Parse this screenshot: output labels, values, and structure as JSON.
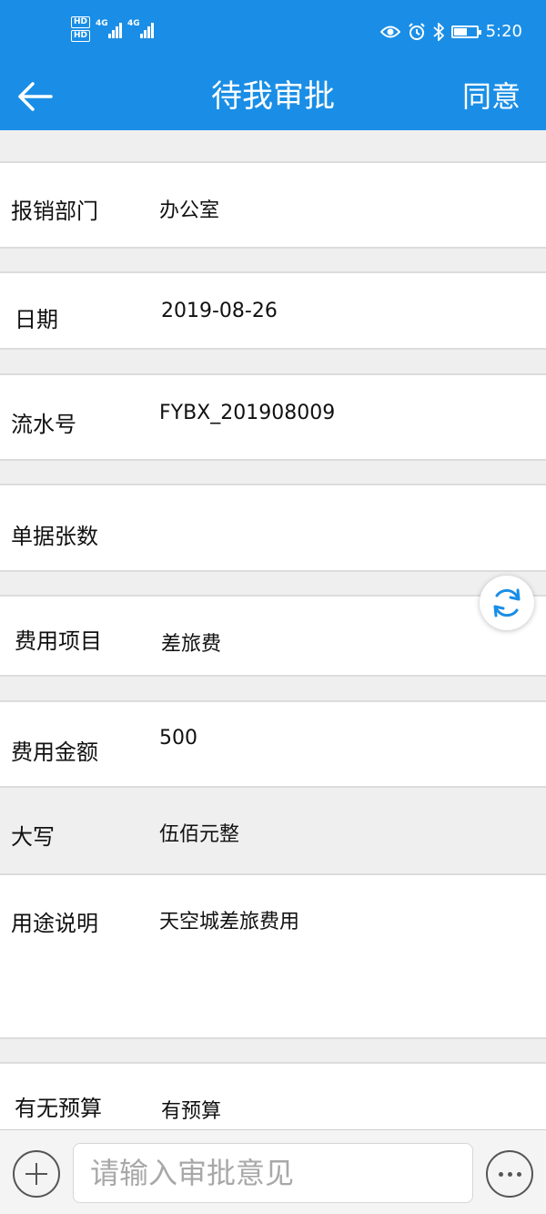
{
  "status_bar": {
    "hd1": "HD",
    "hd2": "HD",
    "net1": "4G",
    "net2": "4G",
    "time": "5:20",
    "icons": [
      "eye-icon",
      "alarm-icon",
      "bluetooth-icon",
      "battery-icon"
    ]
  },
  "nav": {
    "title": "待我审批",
    "action": "同意",
    "back_icon": "arrow-left-icon"
  },
  "fields": {
    "dept": {
      "label": "报销部门",
      "value": "办公室"
    },
    "date": {
      "label": "日期",
      "value": "2019-08-26"
    },
    "serial": {
      "label": "流水号",
      "value": "FYBX_201908009"
    },
    "count": {
      "label": "单据张数",
      "value": ""
    },
    "item": {
      "label": "费用项目",
      "value": "差旅费"
    },
    "amount": {
      "label": "费用金额",
      "value": "500"
    },
    "caps": {
      "label": "大写",
      "value": "伍佰元整"
    },
    "purpose": {
      "label": "用途说明",
      "value": "天空城差旅费用"
    },
    "budget": {
      "label": "有无预算",
      "value": "有预算"
    }
  },
  "bottom": {
    "placeholder": "请输入审批意见"
  },
  "colors": {
    "brand": "#1a8ee6",
    "refresh": "#1a8ee6"
  }
}
